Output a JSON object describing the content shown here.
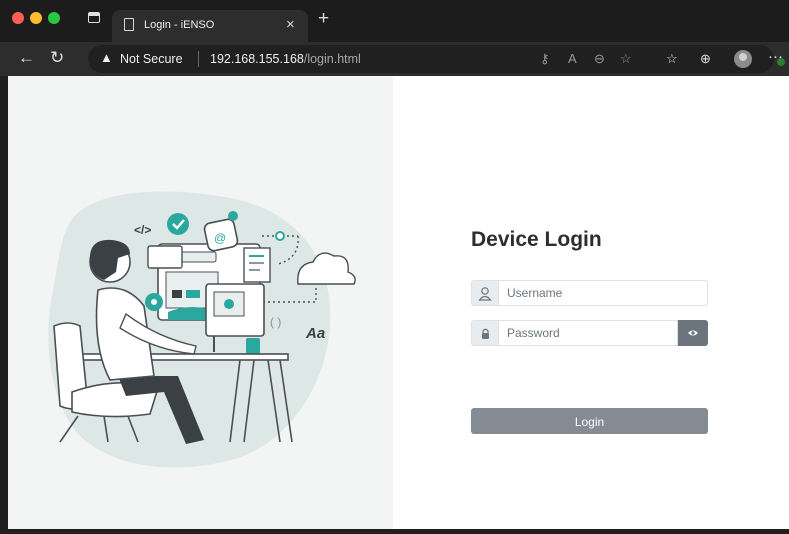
{
  "browser": {
    "tab_title": "Login - iENSO",
    "address": {
      "security_label": "Not Secure",
      "host": "192.168.155.168",
      "path": "/login.html"
    }
  },
  "illustration": {
    "code_tag": "</>",
    "parens": "( )",
    "font_sample": "Aa",
    "at_symbol": "@"
  },
  "login": {
    "heading": "Device Login",
    "username_placeholder": "Username",
    "password_placeholder": "Password",
    "login_label": "Login"
  },
  "colors": {
    "accent_teal": "#2aa8a0",
    "button_gray": "#858b93",
    "heading_text": "#2b2f33"
  }
}
